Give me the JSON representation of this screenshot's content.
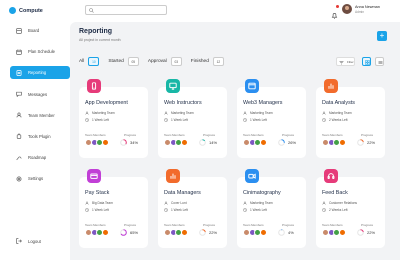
{
  "app": {
    "name": "Compute"
  },
  "sidebar": {
    "items": [
      {
        "label": "Board",
        "icon": "board-icon",
        "active": false
      },
      {
        "label": "Plan Schedule",
        "icon": "calendar-icon",
        "active": false
      },
      {
        "label": "Reporting",
        "icon": "report-icon",
        "active": true
      },
      {
        "label": "Messages",
        "icon": "message-icon",
        "active": false
      },
      {
        "label": "Team Member",
        "icon": "team-icon",
        "active": false
      },
      {
        "label": "Tools Plugin",
        "icon": "plugin-icon",
        "active": false
      },
      {
        "label": "Roadmap",
        "icon": "roadmap-icon",
        "active": false
      },
      {
        "label": "Settings",
        "icon": "gear-icon",
        "active": false
      }
    ],
    "logout": "Logout"
  },
  "user": {
    "name": "Anna Newman",
    "role": "Admin"
  },
  "header": {
    "title": "Reporting",
    "subtitle": "All project in current month",
    "add_label": "+"
  },
  "filters": [
    {
      "label": "All",
      "count": "10",
      "selected": true
    },
    {
      "label": "Started",
      "count": "05",
      "selected": false
    },
    {
      "label": "Approval",
      "count": "03",
      "selected": false
    },
    {
      "label": "Finished",
      "count": "12",
      "selected": false
    }
  ],
  "view": {
    "filter_label": "Filter"
  },
  "card_labels": {
    "members": "Team Members",
    "progress": "Progress"
  },
  "cards": [
    {
      "title": "App Development",
      "team": "Marketing Team",
      "time": "1 Week Left",
      "progress": "34%",
      "color": "#e63b7a",
      "icon": "phone-icon"
    },
    {
      "title": "Web Instructors",
      "team": "Marketing Team",
      "time": "1 Week Left",
      "progress": "14%",
      "color": "#18b7a6",
      "icon": "monitor-icon"
    },
    {
      "title": "Web3 Managers",
      "team": "Marketing Team",
      "time": "1 Week Left",
      "progress": "26%",
      "color": "#2b8ff0",
      "icon": "browser-icon"
    },
    {
      "title": "Data Analysts",
      "team": "Marketing Team",
      "time": "2 Weeks Left",
      "progress": "22%",
      "color": "#f26b2c",
      "icon": "chart-icon"
    },
    {
      "title": "Pay Stack",
      "team": "Big Data Team",
      "time": "1 Week Left",
      "progress": "65%",
      "color": "#c13fd6",
      "icon": "card-icon"
    },
    {
      "title": "Data Managers",
      "team": "Cover Lunt",
      "time": "1 Week Left",
      "progress": "22%",
      "color": "#f26b2c",
      "icon": "chart-icon"
    },
    {
      "title": "Cinimatography",
      "team": "Marketing Team",
      "time": "1 Week Left",
      "progress": "4%",
      "color": "#2b8ff0",
      "icon": "camera-icon"
    },
    {
      "title": "Feed Back",
      "team": "Customer Relations",
      "time": "2 Weeks Left",
      "progress": "22%",
      "color": "#e63b7a",
      "icon": "headset-icon"
    }
  ],
  "colors": {
    "accent": "#1aa3e8",
    "background": "#f2f3f5"
  }
}
